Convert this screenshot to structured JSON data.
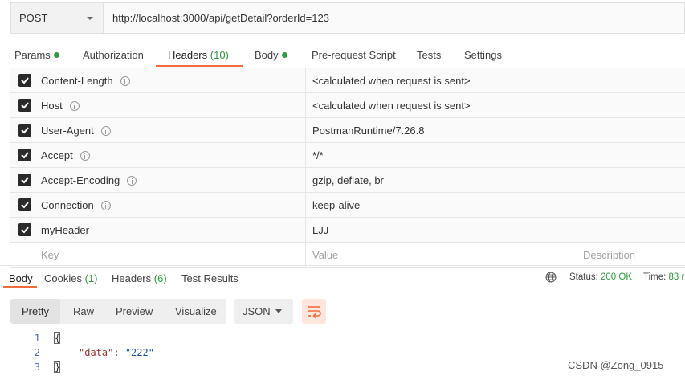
{
  "request": {
    "method": "POST",
    "url": "http://localhost:3000/api/getDetail?orderId=123"
  },
  "request_tabs": {
    "params": "Params",
    "authorization": "Authorization",
    "headers": "Headers",
    "headers_count": "(10)",
    "body": "Body",
    "prerequest": "Pre-request Script",
    "tests": "Tests",
    "settings": "Settings"
  },
  "headers": [
    {
      "key": "Content-Length",
      "value": "<calculated when request is sent>",
      "info": true,
      "checked": true
    },
    {
      "key": "Host",
      "value": "<calculated when request is sent>",
      "info": true,
      "checked": true
    },
    {
      "key": "User-Agent",
      "value": "PostmanRuntime/7.26.8",
      "info": true,
      "checked": true
    },
    {
      "key": "Accept",
      "value": "*/*",
      "info": true,
      "checked": true
    },
    {
      "key": "Accept-Encoding",
      "value": "gzip, deflate, br",
      "info": true,
      "checked": true
    },
    {
      "key": "Connection",
      "value": "keep-alive",
      "info": true,
      "checked": true
    },
    {
      "key": "myHeader",
      "value": "LJJ",
      "info": false,
      "checked": true
    }
  ],
  "headers_placeholder": {
    "key": "Key",
    "value": "Value",
    "description": "Description"
  },
  "response_tabs": {
    "body": "Body",
    "cookies": "Cookies",
    "cookies_count": "(1)",
    "headers": "Headers",
    "headers_count": "(6)",
    "test_results": "Test Results"
  },
  "response_status": {
    "status_label": "Status:",
    "status_value": "200 OK",
    "time_label": "Time:",
    "time_value": "83 r"
  },
  "body_view": {
    "pretty": "Pretty",
    "raw": "Raw",
    "preview": "Preview",
    "visualize": "Visualize",
    "format": "JSON"
  },
  "code": {
    "line_numbers": [
      "1",
      "2",
      "3"
    ],
    "open_brace": "{",
    "key": "\"data\"",
    "colon": ": ",
    "value": "\"222\"",
    "close_brace": "}"
  },
  "watermark": "CSDN @Zong_0915",
  "colors": {
    "accent": "#f26b3a",
    "success": "#2e9b3f"
  }
}
